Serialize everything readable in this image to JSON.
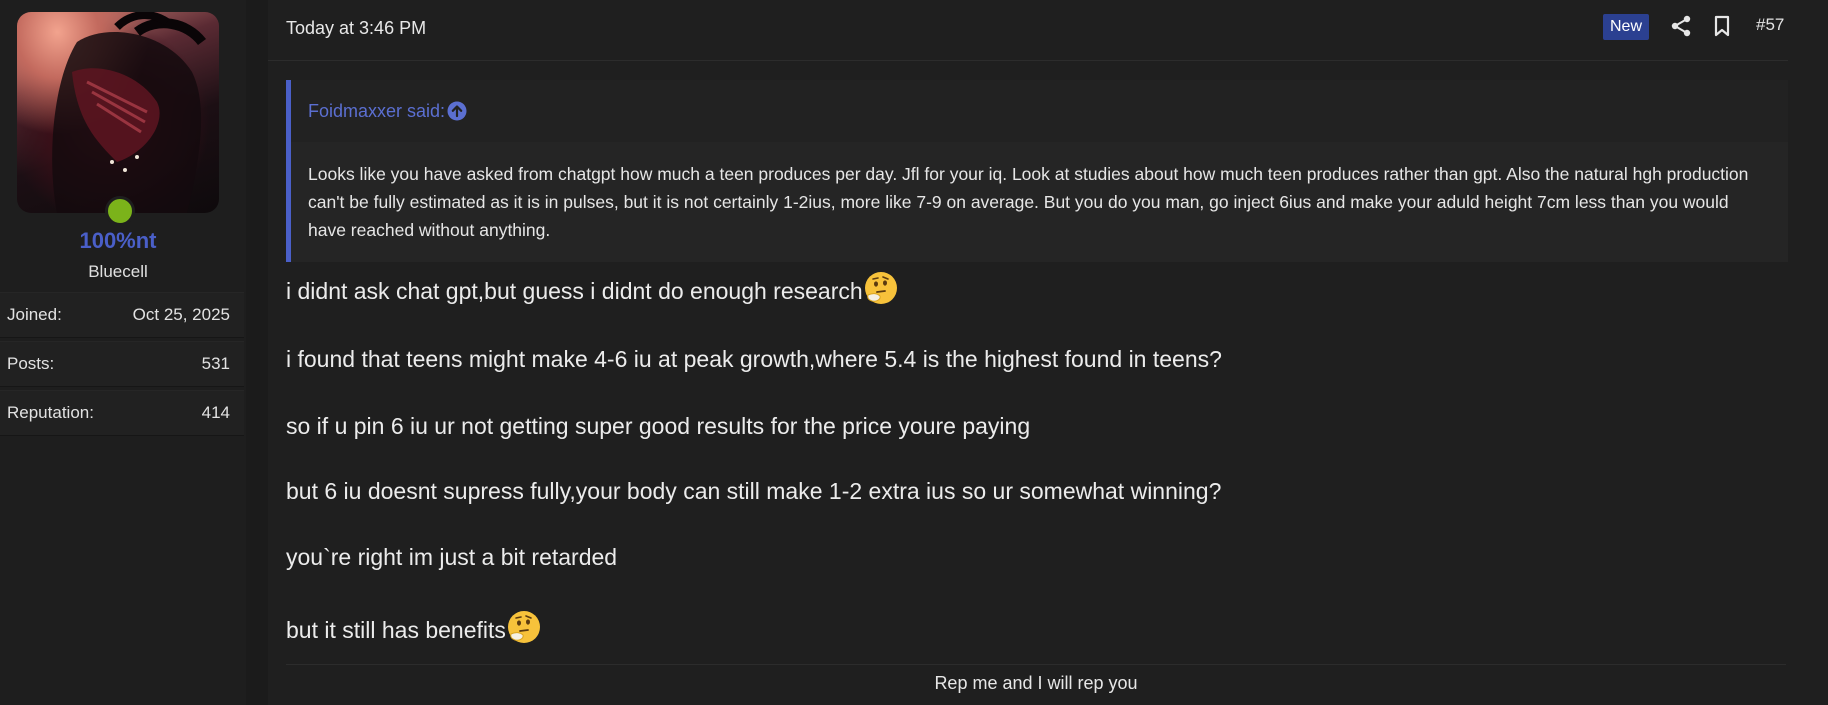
{
  "user": {
    "username": "100%nt",
    "title": "Bluecell",
    "online": true,
    "stats": [
      {
        "label": "Joined:",
        "value": "Oct 25, 2025"
      },
      {
        "label": "Posts:",
        "value": "531"
      },
      {
        "label": "Reputation:",
        "value": "414"
      }
    ]
  },
  "post": {
    "date": "Today at 3:46 PM",
    "badge": "New",
    "number": "#57",
    "quote": {
      "author": "Foidmaxxer said:",
      "text": "Looks like you have asked from chatgpt how much a teen produces per day. Jfl for your iq. Look at studies about how much teen produces rather than gpt. Also the natural hgh production can't be fully estimated as it is in pulses, but it is not certainly 1-2ius, more like 7-9 on average. But you do you man, go inject 6ius and make your aduld height 7cm less than you would have reached without anything."
    },
    "lines": [
      "i didnt ask chat gpt,but guess i didnt do enough research",
      "i found that teens might make 4-6 iu at peak growth,where 5.4 is the highest found in teens?",
      "so if u pin 6 iu ur not getting super good results for the price youre paying",
      "but 6 iu doesnt supress fully,your body can still make 1-2 extra ius so ur somewhat winning?",
      "you`re right im just a bit retarded",
      "but it still has benefits"
    ],
    "emoji_name": "thinking-face-emoji",
    "signature": "Rep me and I will rep you"
  },
  "colors": {
    "accent": "#4a5fc8",
    "badge": "#2b4091",
    "online": "#7bb31a",
    "background": "#1f1f1f"
  },
  "icons": [
    "share-icon",
    "bookmark-icon",
    "arrow-up-circle-icon",
    "thinking-face-emoji"
  ]
}
